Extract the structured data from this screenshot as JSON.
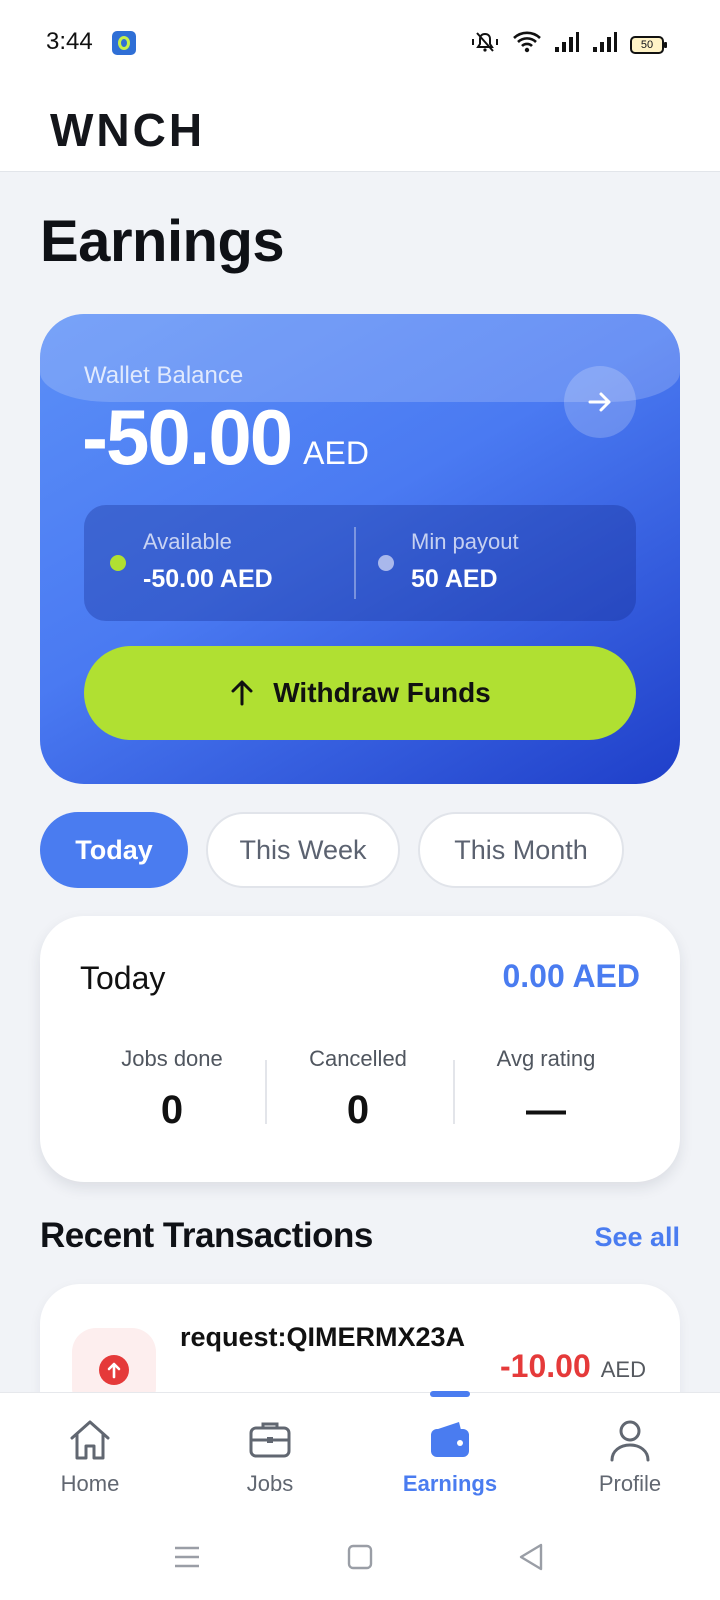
{
  "status_bar": {
    "time": "3:44",
    "app_icon": "tips-bulb-icon",
    "icons": [
      "mute-vibrate-icon",
      "wifi-icon",
      "signal-icon",
      "signal-icon"
    ],
    "battery": "50"
  },
  "header": {
    "brand": "WNCH"
  },
  "page": {
    "title": "Earnings"
  },
  "wallet": {
    "label": "Wallet Balance",
    "amount": "-50.00",
    "currency": "AED",
    "available_label": "Available",
    "available_value": "-50.00 AED",
    "min_payout_label": "Min payout",
    "min_payout_value": "50 AED",
    "withdraw_label": "Withdraw Funds",
    "colors": {
      "card_start": "#5b8ff7",
      "card_end": "#1f3fc9",
      "accent": "#b0e032"
    }
  },
  "period_tabs": [
    {
      "label": "Today",
      "active": true
    },
    {
      "label": "This Week",
      "active": false
    },
    {
      "label": "This Month",
      "active": false
    }
  ],
  "summary": {
    "title": "Today",
    "total": "0.00 AED",
    "stats": [
      {
        "label": "Jobs done",
        "value": "0"
      },
      {
        "label": "Cancelled",
        "value": "0"
      },
      {
        "label": "Avg rating",
        "value": "—"
      }
    ]
  },
  "transactions": {
    "title": "Recent Transactions",
    "see_all": "See all",
    "items": [
      {
        "name": "request:QIMERMX23A",
        "amount": "-10.00",
        "currency": "AED",
        "icon": "arrow-up-circle-icon"
      }
    ]
  },
  "bottom_nav": {
    "items": [
      {
        "label": "Home",
        "icon": "home-icon"
      },
      {
        "label": "Jobs",
        "icon": "briefcase-icon"
      },
      {
        "label": "Earnings",
        "icon": "wallet-icon"
      },
      {
        "label": "Profile",
        "icon": "user-icon"
      }
    ],
    "active": "Earnings"
  },
  "theme": {
    "primary": "#4a7cf0",
    "negative": "#e53a3a",
    "background": "#f1f3f7"
  }
}
